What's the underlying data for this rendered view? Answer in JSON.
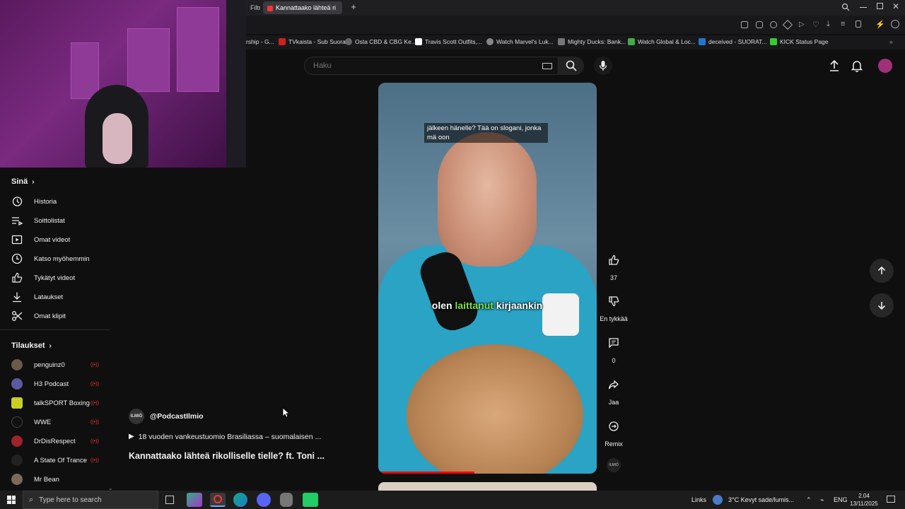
{
  "browser": {
    "tabs": [
      {
        "label": "Filtrai"
      },
      {
        "label": "Kannattaako lähteä ri"
      }
    ],
    "bookmarks": [
      {
        "label": "rship - G..."
      },
      {
        "label": "TVkaista - Sub Suora"
      },
      {
        "label": "Osta CBD & CBG Ke..."
      },
      {
        "label": "Travis Scott Outfits,..."
      },
      {
        "label": "Watch Marvel's Luk..."
      },
      {
        "label": "Mighty Ducks: Bank..."
      },
      {
        "label": "Watch Global & Loc..."
      },
      {
        "label": "deceived - SUORAT..."
      },
      {
        "label": "KICK Status Page"
      }
    ]
  },
  "header": {
    "search_placeholder": "Haku"
  },
  "sidebar": {
    "you_title": "Sinä",
    "you_items": [
      {
        "label": "Historia",
        "icon": "history-icon"
      },
      {
        "label": "Soittolistat",
        "icon": "playlists-icon"
      },
      {
        "label": "Omat videot",
        "icon": "your-videos-icon"
      },
      {
        "label": "Katso myöhemmin",
        "icon": "watch-later-icon"
      },
      {
        "label": "Tykätyt videot",
        "icon": "liked-videos-icon"
      },
      {
        "label": "Lataukset",
        "icon": "downloads-icon"
      },
      {
        "label": "Omat klipit",
        "icon": "clips-icon"
      }
    ],
    "subs_title": "Tilaukset",
    "subscriptions": [
      {
        "label": "penguinz0",
        "color": "#6a5a4a"
      },
      {
        "label": "H3 Podcast",
        "color": "#5a5aa0"
      },
      {
        "label": "talkSPORT Boxing",
        "color": "#c8d020"
      },
      {
        "label": "WWE",
        "color": "#111111"
      },
      {
        "label": "DrDisRespect",
        "color": "#a0222a"
      },
      {
        "label": "A State Of Trance",
        "color": "#222222"
      },
      {
        "label": "Mr Bean",
        "color": "#7a6a5a"
      }
    ]
  },
  "video": {
    "caption_top": "jälkeen hänelle? Tää on slogani, jonka mä oon",
    "caption_mid_a": "olen",
    "caption_mid_b": "laittanut",
    "caption_mid_c": "kirjaankin",
    "progress": 0.44
  },
  "actions": {
    "likes": "37",
    "dislike_label": "En tykkää",
    "comments": "0",
    "share_label": "Jaa",
    "remix_label": "Remix"
  },
  "channel": {
    "handle": "@PodcastIlmio",
    "avatar_text": "ILMIÖ"
  },
  "playlist": {
    "label": "18 vuoden vankeustuomio Brasiliassa – suomalaisen ..."
  },
  "title": "Kannattaako lähteä rikolliselle tielle? ft. Toni ...",
  "taskbar": {
    "search_placeholder": "Type here to search",
    "links": "Links",
    "weather": "3°C  Kevyt sade/lumis...",
    "lang": "ENG",
    "time": "2.04",
    "date": "13/11/2025"
  },
  "colors": {
    "background": "#0f0f0f",
    "progress": "#ff0000",
    "accent_green": "#7ee04a",
    "live_red": "#ff3333"
  }
}
